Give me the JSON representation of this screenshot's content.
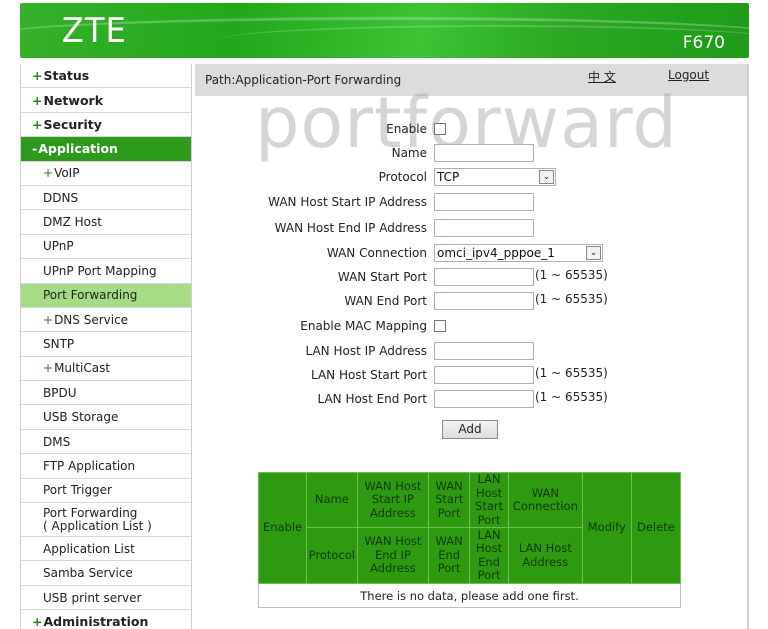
{
  "header": {
    "logo": "ZTE",
    "model": "F670",
    "brand_color": "#2e9a1c"
  },
  "sidebar": {
    "items": [
      {
        "label": "Status",
        "prefix": "+",
        "level": "top"
      },
      {
        "label": "Network",
        "prefix": "+",
        "level": "top"
      },
      {
        "label": "Security",
        "prefix": "+",
        "level": "top"
      },
      {
        "label": "Application",
        "prefix": "-",
        "level": "top",
        "state": "expanded"
      },
      {
        "label": "VoIP",
        "prefix": "+",
        "level": "sub"
      },
      {
        "label": "DDNS",
        "prefix": "",
        "level": "sub"
      },
      {
        "label": "DMZ Host",
        "prefix": "",
        "level": "sub"
      },
      {
        "label": "UPnP",
        "prefix": "",
        "level": "sub"
      },
      {
        "label": "UPnP Port Mapping",
        "prefix": "",
        "level": "sub"
      },
      {
        "label": "Port Forwarding",
        "prefix": "",
        "level": "sub",
        "state": "selected"
      },
      {
        "label": "DNS Service",
        "prefix": "+",
        "level": "sub"
      },
      {
        "label": "SNTP",
        "prefix": "",
        "level": "sub"
      },
      {
        "label": "MultiCast",
        "prefix": "+",
        "level": "sub"
      },
      {
        "label": "BPDU",
        "prefix": "",
        "level": "sub"
      },
      {
        "label": "USB Storage",
        "prefix": "",
        "level": "sub"
      },
      {
        "label": "DMS",
        "prefix": "",
        "level": "sub"
      },
      {
        "label": "FTP Application",
        "prefix": "",
        "level": "sub"
      },
      {
        "label": "Port Trigger",
        "prefix": "",
        "level": "sub"
      },
      {
        "label": "Port Forwarding",
        "label2": "( Application List )",
        "prefix": "",
        "level": "sub"
      },
      {
        "label": "Application List",
        "prefix": "",
        "level": "sub"
      },
      {
        "label": "Samba Service",
        "prefix": "",
        "level": "sub"
      },
      {
        "label": "USB print server",
        "prefix": "",
        "level": "sub"
      },
      {
        "label": "Administration",
        "prefix": "+",
        "level": "top"
      }
    ]
  },
  "pathbar": {
    "path": "Path:Application-Port Forwarding",
    "language_link": "中 文",
    "logout_link": "Logout"
  },
  "watermark": "portforward",
  "form": {
    "enable_label": "Enable",
    "enable_checked": false,
    "name_label": "Name",
    "name_value": "",
    "protocol_label": "Protocol",
    "protocol_value": "TCP",
    "wan_host_start_ip_label": "WAN Host Start IP Address",
    "wan_host_start_ip_value": "",
    "wan_host_end_ip_label": "WAN Host End IP Address",
    "wan_host_end_ip_value": "",
    "wan_connection_label": "WAN Connection",
    "wan_connection_value": "omci_ipv4_pppoe_1",
    "wan_start_port_label": "WAN Start Port",
    "wan_start_port_value": "",
    "wan_end_port_label": "WAN End Port",
    "wan_end_port_value": "",
    "enable_mac_label": "Enable MAC Mapping",
    "enable_mac_checked": false,
    "lan_host_ip_label": "LAN Host IP Address",
    "lan_host_ip_value": "",
    "lan_host_start_port_label": "LAN Host Start Port",
    "lan_host_start_port_value": "",
    "lan_host_end_port_label": "LAN Host End Port",
    "lan_host_end_port_value": "",
    "port_range_hint": "(1 ~ 65535)",
    "add_button": "Add"
  },
  "table": {
    "headers": {
      "enable": "Enable",
      "name": "Name",
      "wan_host_start_ip": "WAN Host Start IP Address",
      "wan_start_port": "WAN Start Port",
      "lan_host_start_port": "LAN Host Start Port",
      "wan_connection": "WAN Connection",
      "modify": "Modify",
      "delete": "Delete",
      "protocol": "Protocol",
      "wan_host_end_ip": "WAN Host End IP Address",
      "wan_end_port": "WAN End Port",
      "lan_host_end_port": "LAN Host End Port",
      "lan_host_address": "LAN Host Address"
    },
    "empty_message": "There is no data, please add one first."
  }
}
